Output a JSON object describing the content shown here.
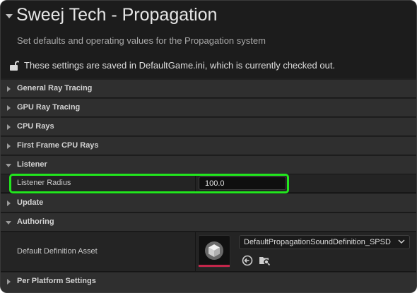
{
  "header": {
    "title": "Sweej Tech - Propagation",
    "subtitle": "Set defaults and operating values for the Propagation system",
    "save_notice": "These settings are saved in DefaultGame.ini, which is currently checked out."
  },
  "categories": [
    {
      "label": "General Ray Tracing",
      "expanded": false
    },
    {
      "label": "GPU Ray Tracing",
      "expanded": false
    },
    {
      "label": "CPU Rays",
      "expanded": false
    },
    {
      "label": "First Frame CPU Rays",
      "expanded": false
    },
    {
      "label": "Listener",
      "expanded": true
    },
    {
      "label": "Update",
      "expanded": false
    },
    {
      "label": "Authoring",
      "expanded": true
    },
    {
      "label": "Per Platform Settings",
      "expanded": false
    }
  ],
  "listener": {
    "radius_label": "Listener Radius",
    "radius_value": "100.0"
  },
  "authoring": {
    "default_asset_label": "Default Definition Asset",
    "default_asset_value": "DefaultPropagationSoundDefinition_SPSD"
  },
  "colors": {
    "highlight": "#22e61e",
    "asset_accent": "#c2264a"
  }
}
